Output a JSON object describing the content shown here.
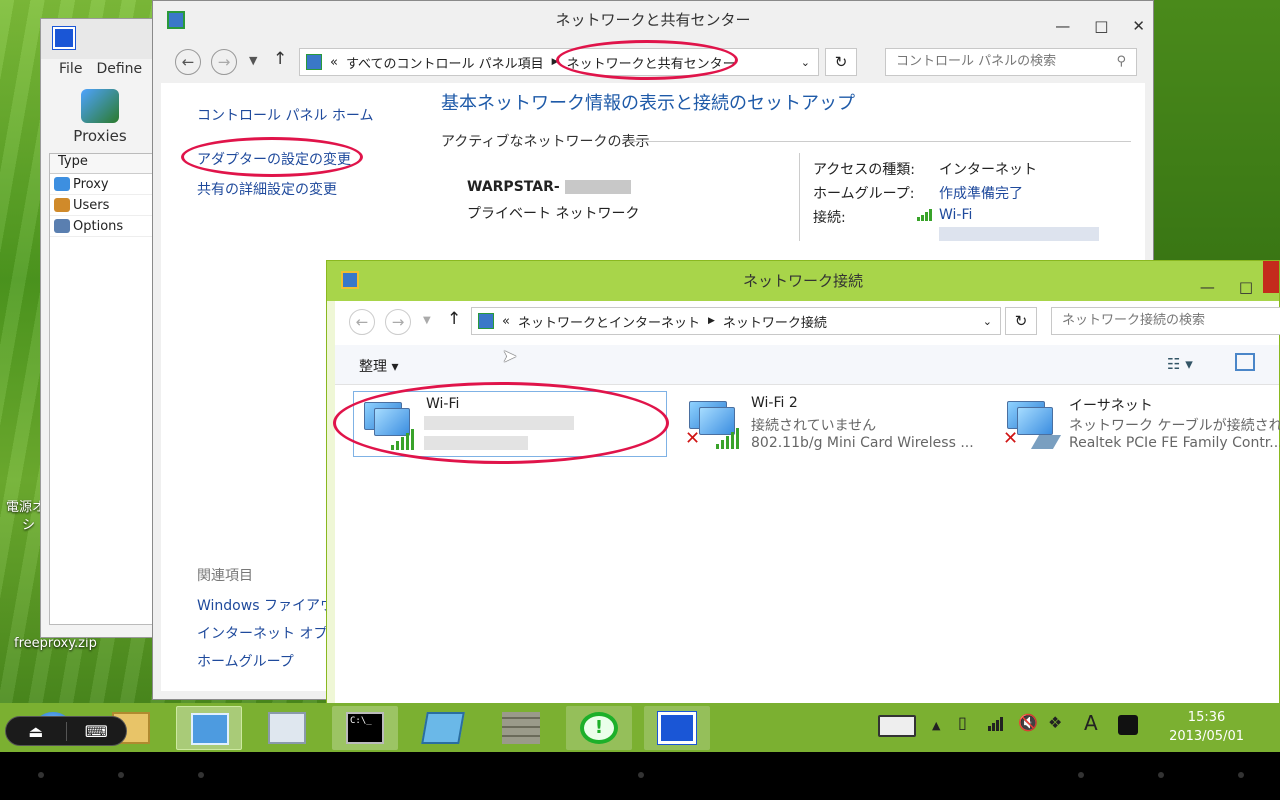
{
  "desktop": {
    "icon_labels": [
      "freeproxy.zip",
      "電源オ",
      "シ"
    ]
  },
  "proxy_app": {
    "menu": [
      "File",
      "Define"
    ],
    "toolbar_label": "Proxies",
    "list_header": "Type",
    "list_items": [
      "Proxy",
      "Users",
      "Options"
    ]
  },
  "network_center": {
    "title": "ネットワークと共有センター",
    "window_controls": [
      "—",
      "□",
      "✕"
    ],
    "breadcrumb": [
      "«",
      "すべてのコントロール パネル項目",
      "ネットワークと共有センター"
    ],
    "search_placeholder": "コントロール パネルの検索",
    "sidebar": {
      "links": [
        "コントロール パネル ホーム",
        "アダプターの設定の変更",
        "共有の詳細設定の変更"
      ],
      "related_header": "関連項目",
      "related_links": [
        "Windows ファイアウォ",
        "インターネット オプショ",
        "ホームグループ"
      ]
    },
    "heading": "基本ネットワーク情報の表示と接続のセットアップ",
    "section_label": "アクティブなネットワークの表示",
    "network": {
      "name": "WARPSTAR-",
      "type": "プライベート ネットワーク",
      "access_label": "アクセスの種類:",
      "access_value": "インターネット",
      "homegroup_label": "ホームグループ:",
      "homegroup_value": "作成準備完了",
      "connection_label": "接続:",
      "connection_value": "Wi-Fi"
    }
  },
  "network_connections": {
    "title": "ネットワーク接続",
    "window_controls": [
      "—",
      "□"
    ],
    "breadcrumb": [
      "«",
      "ネットワークとインターネット",
      "ネットワーク接続"
    ],
    "search_placeholder": "ネットワーク接続の検索",
    "organize_label": "整理 ▾",
    "adapters": [
      {
        "name": "Wi-Fi",
        "status": "",
        "device": ""
      },
      {
        "name": "Wi-Fi 2",
        "status": "接続されていません",
        "device": "802.11b/g Mini Card Wireless ..."
      },
      {
        "name": "イーサネット",
        "status": "ネットワーク ケーブルが接続されていま",
        "device": "Realtek PCIe FE Family Contr..."
      }
    ]
  },
  "taskbar": {
    "tray_letter": "A",
    "time": "15:36",
    "date": "2013/05/01"
  },
  "colors": {
    "annotation_circle": "#e0144a",
    "link": "#1f4a9c",
    "taskbar": "#7bb031",
    "connections_titlebar": "#a8d54a"
  }
}
